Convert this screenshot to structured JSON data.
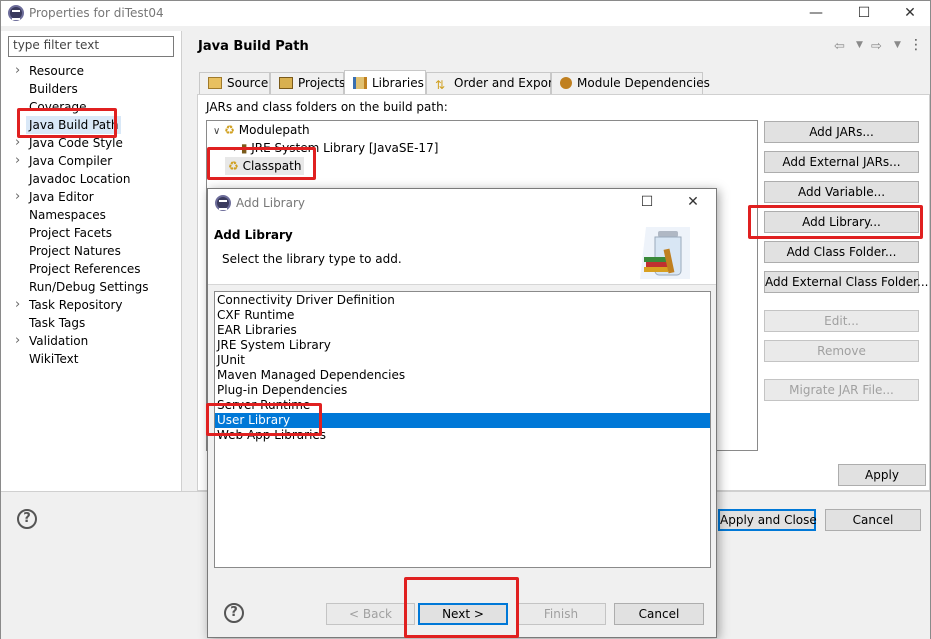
{
  "window": {
    "title": "Properties for diTest04",
    "controls": [
      "minimize-icon",
      "maximize-icon",
      "close-icon"
    ]
  },
  "filter": {
    "value": "type filter text"
  },
  "tree": [
    {
      "label": "Resource",
      "expandable": true
    },
    {
      "label": "Builders",
      "expandable": false
    },
    {
      "label": "Coverage",
      "expandable": false
    },
    {
      "label": "Java Build Path",
      "expandable": false,
      "selected": true
    },
    {
      "label": "Java Code Style",
      "expandable": true
    },
    {
      "label": "Java Compiler",
      "expandable": true
    },
    {
      "label": "Javadoc Location",
      "expandable": false
    },
    {
      "label": "Java Editor",
      "expandable": true
    },
    {
      "label": "Namespaces",
      "expandable": false
    },
    {
      "label": "Project Facets",
      "expandable": false
    },
    {
      "label": "Project Natures",
      "expandable": false
    },
    {
      "label": "Project References",
      "expandable": false
    },
    {
      "label": "Run/Debug Settings",
      "expandable": false
    },
    {
      "label": "Task Repository",
      "expandable": true
    },
    {
      "label": "Task Tags",
      "expandable": false
    },
    {
      "label": "Validation",
      "expandable": true
    },
    {
      "label": "WikiText",
      "expandable": false
    }
  ],
  "page": {
    "title": "Java Build Path",
    "tabs": [
      "Source",
      "Projects",
      "Libraries",
      "Order and Export",
      "Module Dependencies"
    ],
    "active_tab": "Libraries",
    "jars_label": "JARs and class folders on the build path:",
    "build_path": {
      "modulepath": "Modulepath",
      "jre": "JRE System Library [JavaSE-17]",
      "classpath": "Classpath"
    },
    "buttons": {
      "add_jars": "Add JARs...",
      "add_external_jars": "Add External JARs...",
      "add_variable": "Add Variable...",
      "add_library": "Add Library...",
      "add_class_folder": "Add Class Folder...",
      "add_external_class_folder": "Add External Class Folder...",
      "edit": "Edit...",
      "remove": "Remove",
      "migrate": "Migrate JAR File..."
    },
    "apply": "Apply",
    "apply_close": "Apply and Close",
    "cancel": "Cancel"
  },
  "dialog": {
    "title": "Add Library",
    "heading": "Add Library",
    "subtitle": "Select the library type to add.",
    "items": [
      "Connectivity Driver Definition",
      "CXF Runtime",
      "EAR Libraries",
      "JRE System Library",
      "JUnit",
      "Maven Managed Dependencies",
      "Plug-in Dependencies",
      "Server Runtime",
      "User Library",
      "Web App Libraries"
    ],
    "selected": "User Library",
    "buttons": {
      "back": "< Back",
      "next": "Next >",
      "finish": "Finish",
      "cancel": "Cancel"
    }
  },
  "colors": {
    "accent": "#0078d7",
    "highlight": "#e02020",
    "selection_bg": "#d9e8f7"
  }
}
